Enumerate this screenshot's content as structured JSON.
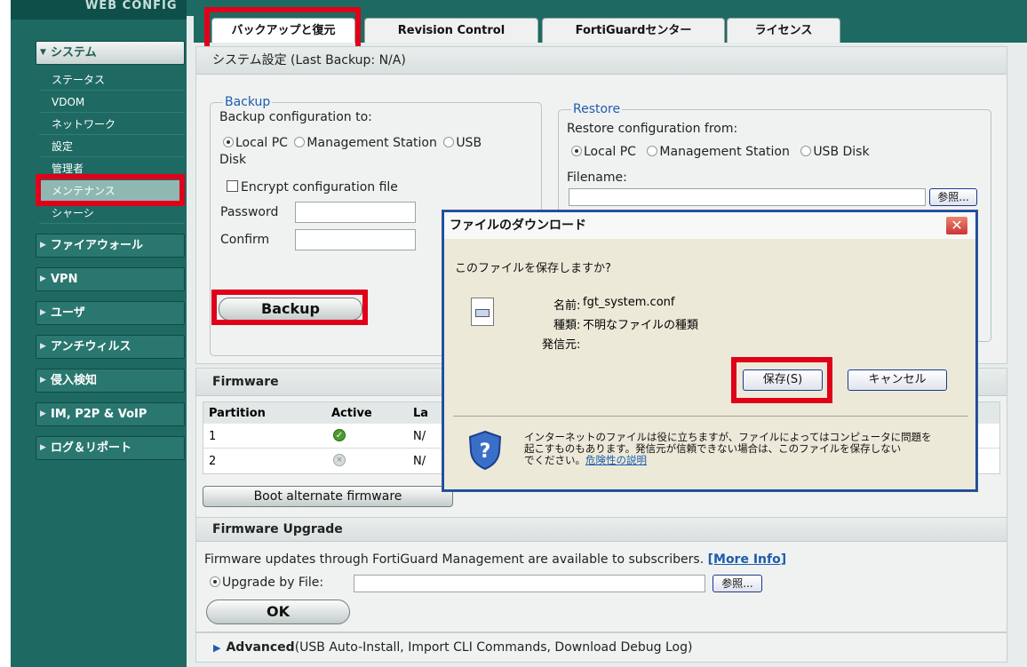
{
  "brand": "WEB CONFIG",
  "sidebar": {
    "system_header": "システム",
    "system_items": [
      "ステータス",
      "VDOM",
      "ネットワーク",
      "設定",
      "管理者",
      "メンテナンス",
      "シャーシ"
    ],
    "categories": [
      "ファイアウォール",
      "VPN",
      "ユーザ",
      "アンチウィルス",
      "侵入検知",
      "IM, P2P & VoIP",
      "ログ＆リポート"
    ]
  },
  "tabs": [
    "バックアップと復元",
    "Revision Control",
    "FortiGuardセンター",
    "ライセンス"
  ],
  "system_settings": {
    "title": "システム設定 (Last Backup: N/A)",
    "backup": {
      "legend": "Backup",
      "to_label": "Backup configuration to:",
      "opt_local": "Local PC",
      "opt_mgmt": "Management Station",
      "opt_usb_1": "USB",
      "opt_usb_2": "Disk",
      "encrypt": "Encrypt configuration file",
      "password": "Password",
      "confirm": "Confirm",
      "button": "Backup"
    },
    "restore": {
      "legend": "Restore",
      "from_label": "Restore configuration from:",
      "opt_local": "Local PC",
      "opt_mgmt": "Management Station",
      "opt_usb": "USB Disk",
      "filename": "Filename:",
      "browse": "参照..."
    }
  },
  "firmware": {
    "title": "Firmware",
    "headers": [
      "Partition",
      "Active",
      "La"
    ],
    "rows": [
      {
        "partition": "1",
        "active": "ok-icon",
        "la": "N/"
      },
      {
        "partition": "2",
        "active": "inactive-icon",
        "la": "N/"
      }
    ],
    "boot_button": "Boot alternate firmware"
  },
  "upgrade": {
    "title": "Firmware Upgrade",
    "info": "Firmware updates through FortiGuard Management are available to subscribers.",
    "more_info": "[More Info]",
    "by_file": "Upgrade by File:",
    "browse": "参照...",
    "ok": "OK"
  },
  "advanced": {
    "label": "Advanced",
    "detail": "(USB Auto-Install, Import CLI Commands, Download Debug Log)"
  },
  "dialog": {
    "title": "ファイルのダウンロード",
    "question": "このファイルを保存しますか?",
    "name_label": "名前:",
    "name_value": "fgt_system.conf",
    "type_label": "種類:",
    "type_value": "不明なファイルの種類",
    "source_label": "発信元:",
    "save": "保存(S)",
    "cancel": "キャンセル",
    "warning_1": "インターネットのファイルは役に立ちますが、ファイルによってはコンピュータに問題を",
    "warning_2": "起こすものもあります。発信元が信頼できない場合は、このファイルを保存しない",
    "warning_3": "でください。",
    "warning_link": "危険性の説明"
  },
  "colors": {
    "highlight": "#e0001a",
    "sidebar": "#1e6a62",
    "link": "#1d5cae"
  }
}
